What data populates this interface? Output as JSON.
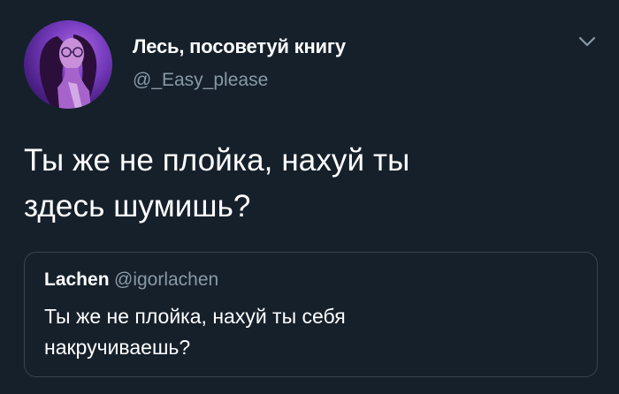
{
  "tweet": {
    "author": {
      "display_name": "Лесь, посоветуй книгу",
      "handle": "@_Easy_please",
      "avatar_icon": "user-avatar-photo"
    },
    "menu_icon": "chevron-down-icon",
    "text_line_1": "Ты же не плойка, нахуй ты",
    "text_line_2": "здесь шумишь?",
    "quoted_tweet": {
      "display_name": "Lachen",
      "handle": "@igorlachen",
      "text_line_1": "Ты же не плойка, нахуй ты себя",
      "text_line_2": "накручиваешь?"
    }
  },
  "colors": {
    "background": "#15202b",
    "text_primary": "#ffffff",
    "text_secondary": "#8899a6",
    "border": "#38444d",
    "avatar_accent": "#7a3ec2"
  }
}
